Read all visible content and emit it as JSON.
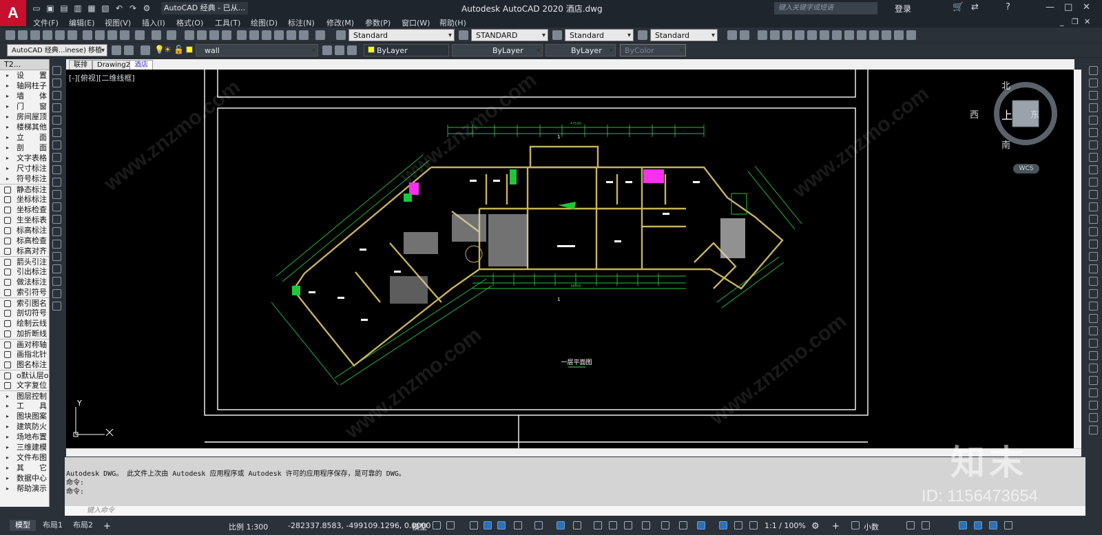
{
  "titlebar": {
    "app_letter": "A",
    "workspace": "AutoCAD 经典 - 已从...",
    "title": "Autodesk AutoCAD 2020    酒店.dwg",
    "search_placeholder": "键入关键字或短语",
    "login": "登录"
  },
  "menu": [
    "文件(F)",
    "编辑(E)",
    "视图(V)",
    "插入(I)",
    "格式(O)",
    "工具(T)",
    "绘图(D)",
    "标注(N)",
    "修改(M)",
    "参数(P)",
    "窗口(W)",
    "帮助(H)"
  ],
  "toolbar1": {
    "text_style": "Standard",
    "dim_style": "STANDARD",
    "table_style": "Standard",
    "mleader_style": "Standard"
  },
  "toolbar2": {
    "workspace": "AutoCAD 经典...inese) 移植",
    "layer": "wall",
    "color": "ByLayer",
    "linetype": "ByLayer",
    "lineweight": "ByLayer",
    "plotstyle": "ByColor"
  },
  "left_panel": {
    "title": "T2...",
    "items": [
      "设　　置",
      "轴网柱子",
      "墙　　体",
      "门　　窗",
      "房间屋顶",
      "楼梯其他",
      "立　　面",
      "剖　　面",
      "文字表格",
      "尺寸标注",
      "符号标注",
      "静态标注",
      "坐标标注",
      "坐标检查",
      "生坐标表",
      "标高标注",
      "标高检查",
      "标高对齐",
      "箭头引注",
      "引出标注",
      "做法标注",
      "索引符号",
      "索引图名",
      "剖切符号",
      "绘制云线",
      "加折断线",
      "画对称轴",
      "画指北针",
      "图名标注",
      "o默认层o",
      "文字复位",
      "图层控制",
      "工　　具",
      "图块图案",
      "建筑防火",
      "场地布置",
      "三维建模",
      "文件布图",
      "其　　它",
      "数据中心",
      "帮助演示"
    ]
  },
  "doc_tabs": [
    "联排",
    "Drawing2",
    "酒店"
  ],
  "canvas": {
    "view_label": "[-][俯视][二维线框]",
    "plan_title": "一层平面图",
    "section_mark": "1",
    "top_dim": "47500",
    "bottom_dim": "38000",
    "ucs_y": "Y"
  },
  "viewcube": {
    "north": "北",
    "south": "南",
    "east": "东",
    "west": "西",
    "top": "上",
    "wcs": "WCS"
  },
  "command": {
    "history": [
      "Autodesk DWG。  此文件上次由 Autodesk 应用程序或 Autodesk 许可的应用程序保存，是可靠的 DWG。",
      "命令:",
      "命令:"
    ],
    "input_placeholder": "键入命令"
  },
  "status": {
    "tabs": [
      "模型",
      "布局1",
      "布局2"
    ],
    "scale": "比例 1:300",
    "coords": "-282337.8583, -499109.1296, 0.0000",
    "model": "模型",
    "annotation_scale": "1:1 / 100%",
    "units": "小数"
  },
  "watermark": {
    "brand": "知末",
    "id": "ID: 1156473654",
    "site": "www.znzmo.com"
  },
  "colors": {
    "accent_red": "#c8102e",
    "canvas": "#000000",
    "wall": "#c9b25a",
    "dims": "#22c53a",
    "frame": "#ffffff"
  }
}
